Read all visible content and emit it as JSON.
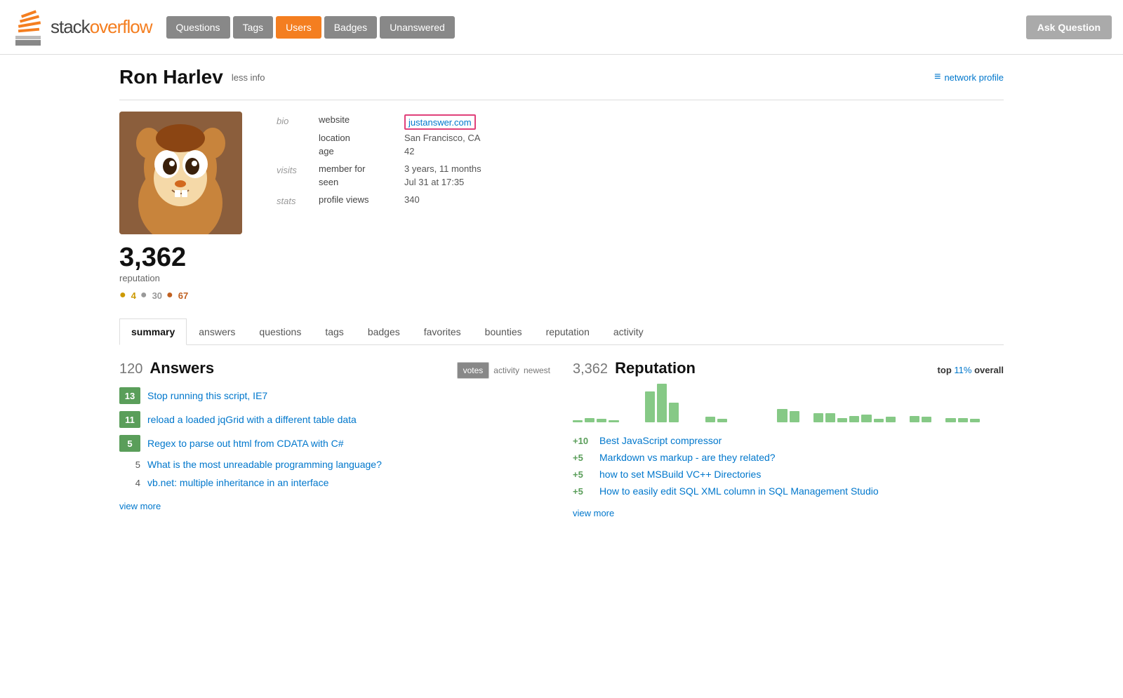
{
  "header": {
    "logo_text": "stackoverflow",
    "nav_items": [
      {
        "label": "Questions",
        "active": false
      },
      {
        "label": "Tags",
        "active": false
      },
      {
        "label": "Users",
        "active": true
      },
      {
        "label": "Badges",
        "active": false
      },
      {
        "label": "Unanswered",
        "active": false
      }
    ],
    "ask_button": "Ask Question"
  },
  "profile": {
    "name": "Ron Harlev",
    "less_info": "less info",
    "network_profile": "network profile",
    "website_label": "website",
    "website_value": "justanswer.com",
    "location_label": "location",
    "location_value": "San Francisco, CA",
    "age_label": "age",
    "age_value": "42",
    "bio_label": "bio",
    "visits_label": "visits",
    "member_for_label": "member for",
    "member_for_value": "3 years, 11 months",
    "seen_label": "seen",
    "seen_value": "Jul 31 at 17:35",
    "stats_label": "stats",
    "profile_views_label": "profile views",
    "profile_views_value": "340",
    "reputation": "3,362",
    "reputation_label": "reputation",
    "badges": {
      "gold_count": "4",
      "silver_count": "30",
      "bronze_count": "67"
    }
  },
  "tabs": {
    "items": [
      {
        "label": "summary",
        "active": true
      },
      {
        "label": "answers",
        "active": false
      },
      {
        "label": "questions",
        "active": false
      },
      {
        "label": "tags",
        "active": false
      },
      {
        "label": "badges",
        "active": false
      },
      {
        "label": "favorites",
        "active": false
      },
      {
        "label": "bounties",
        "active": false
      },
      {
        "label": "reputation",
        "active": false
      },
      {
        "label": "activity",
        "active": false
      }
    ]
  },
  "answers_section": {
    "count": "120",
    "title": "Answers",
    "sort_votes": "votes",
    "sort_activity": "activity",
    "sort_newest": "newest",
    "items": [
      {
        "score": "13",
        "scored": true,
        "title": "Stop running this script, IE7"
      },
      {
        "score": "11",
        "scored": true,
        "title": "reload a loaded jqGrid with a different table data"
      },
      {
        "score": "5",
        "scored": true,
        "title": "Regex to parse out html from CDATA with C#"
      },
      {
        "score": "5",
        "scored": false,
        "title": "What is the most unreadable programming language?"
      },
      {
        "score": "4",
        "scored": false,
        "title": "vb.net: multiple inheritance in an interface"
      }
    ],
    "view_more": "view more"
  },
  "reputation_section": {
    "count": "3,362",
    "title": "Reputation",
    "top_label": "top",
    "top_percent": "11%",
    "top_suffix": "overall",
    "chart_bars": [
      2,
      4,
      3,
      2,
      0,
      0,
      28,
      35,
      18,
      0,
      0,
      5,
      3,
      0,
      0,
      0,
      0,
      12,
      10,
      0,
      8,
      8,
      4,
      6,
      7,
      3,
      5,
      0,
      6,
      5,
      0,
      4,
      4,
      3,
      0,
      0
    ],
    "items": [
      {
        "change": "+10",
        "title": "Best JavaScript compressor"
      },
      {
        "change": "+5",
        "title": "Markdown vs markup - are they related?"
      },
      {
        "change": "+5",
        "title": "how to set MSBuild VC++ Directories"
      },
      {
        "change": "+5",
        "title": "How to easily edit SQL XML column in SQL Management Studio"
      }
    ],
    "view_more": "view more"
  }
}
